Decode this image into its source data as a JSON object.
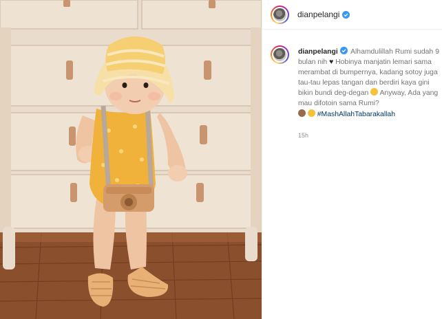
{
  "header": {
    "username": "dianpelangi",
    "verified": true,
    "verified_color": "#3897f0"
  },
  "caption": {
    "username": "dianpelangi",
    "text_part1": "Alhamdulillah Rumi sudah 9 bulan nih",
    "text_part2": "Hobinya manjatin lemari sama merambat di bumpernya, kadang sotoy juga tau-tau lepas tangan dan berdiri kaya gini bikin bundi deg-degan",
    "text_part3": "Anyway, Ada yang mau difotoin sama Rumi?",
    "hashtag": "#MashAllahTabarakallah",
    "time_ago": "15h",
    "emojis": [
      "heart-icon",
      "grimacing-emoji",
      "monkey-emoji",
      "grimacing-emoji"
    ]
  },
  "colors": {
    "username": "#262626",
    "caption_text": "#737373",
    "hashtag": "#00376b",
    "divider": "#efefef"
  }
}
